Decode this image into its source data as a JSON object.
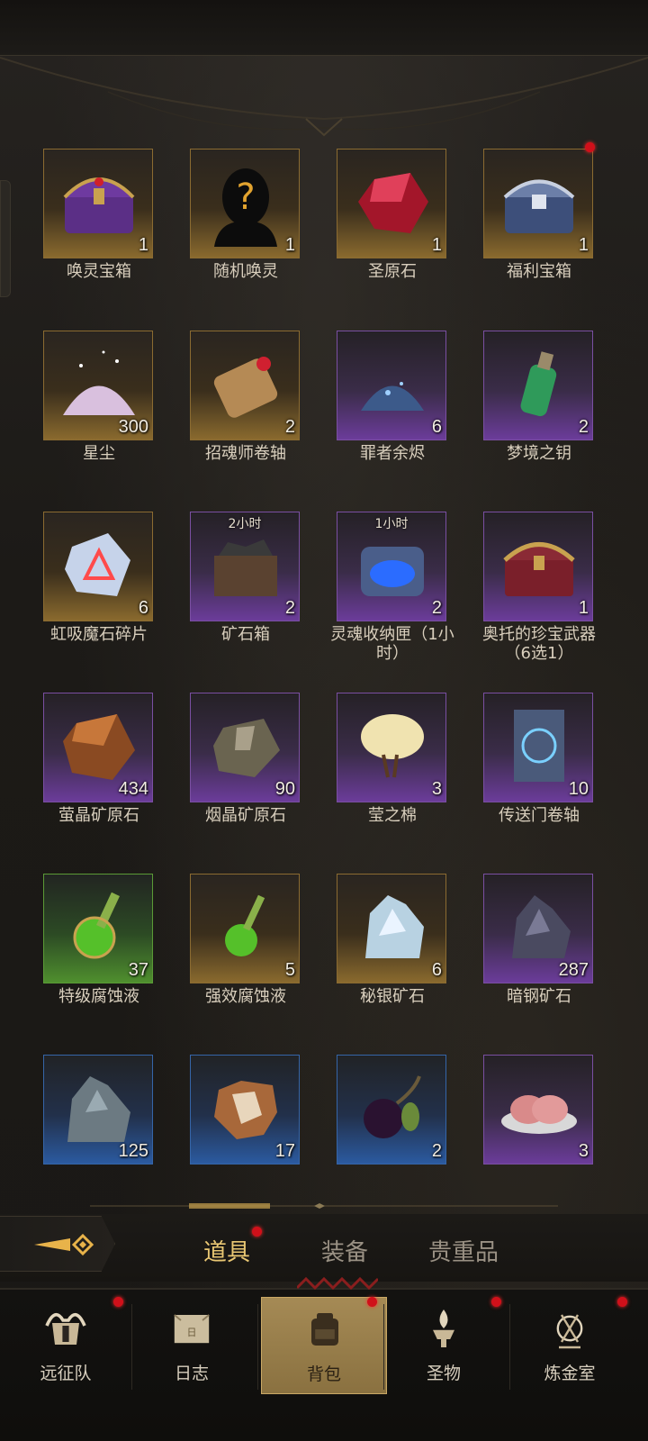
{
  "colors": {
    "gold_frame": "#8b6b31",
    "purple_frame": "#7a4fa2",
    "green_frame": "#5a9a36",
    "blue_frame": "#3565a8",
    "active_tab": "#e9c773",
    "notification_dot": "#d0101a"
  },
  "items": [
    {
      "name": "唤灵宝箱",
      "count": "1",
      "rarity": "gold",
      "icon": "purple-chest-icon",
      "dot": false,
      "timer": ""
    },
    {
      "name": "随机唤灵",
      "count": "1",
      "rarity": "gold",
      "icon": "mystery-silhouette-icon",
      "dot": false,
      "timer": ""
    },
    {
      "name": "圣原石",
      "count": "1",
      "rarity": "gold",
      "icon": "red-crystal-icon",
      "dot": false,
      "timer": ""
    },
    {
      "name": "福利宝箱",
      "count": "1",
      "rarity": "gold",
      "icon": "silver-chest-icon",
      "dot": true,
      "timer": ""
    },
    {
      "name": "星尘",
      "count": "300",
      "rarity": "gold",
      "icon": "stardust-pile-icon",
      "dot": false,
      "timer": ""
    },
    {
      "name": "招魂师卷轴",
      "count": "2",
      "rarity": "gold",
      "icon": "scroll-icon",
      "dot": false,
      "timer": ""
    },
    {
      "name": "罪者余烬",
      "count": "6",
      "rarity": "purple",
      "icon": "ember-pile-icon",
      "dot": false,
      "timer": ""
    },
    {
      "name": "梦境之钥",
      "count": "2",
      "rarity": "purple",
      "icon": "green-vial-icon",
      "dot": false,
      "timer": ""
    },
    {
      "name": "虹吸魔石碎片",
      "count": "6",
      "rarity": "gold",
      "icon": "rune-shard-icon",
      "dot": false,
      "timer": ""
    },
    {
      "name": "矿石箱",
      "count": "2",
      "rarity": "purple",
      "icon": "ore-crate-icon",
      "dot": false,
      "timer": "2小时"
    },
    {
      "name": "灵魂收纳匣（1小时）",
      "count": "2",
      "rarity": "purple",
      "icon": "soul-box-icon",
      "dot": false,
      "timer": "1小时"
    },
    {
      "name": "奥托的珍宝武器（6选1）",
      "count": "1",
      "rarity": "purple",
      "icon": "treasure-chest-icon",
      "dot": false,
      "timer": ""
    },
    {
      "name": "萤晶矿原石",
      "count": "434",
      "rarity": "purple",
      "icon": "amber-ore-icon",
      "dot": false,
      "timer": ""
    },
    {
      "name": "烟晶矿原石",
      "count": "90",
      "rarity": "purple",
      "icon": "smoky-ore-icon",
      "dot": false,
      "timer": ""
    },
    {
      "name": "莹之棉",
      "count": "3",
      "rarity": "purple",
      "icon": "cotton-icon",
      "dot": false,
      "timer": ""
    },
    {
      "name": "传送门卷轴",
      "count": "10",
      "rarity": "purple",
      "icon": "portal-scroll-icon",
      "dot": false,
      "timer": ""
    },
    {
      "name": "特级腐蚀液",
      "count": "37",
      "rarity": "green",
      "icon": "green-flask-icon",
      "dot": false,
      "timer": ""
    },
    {
      "name": "强效腐蚀液",
      "count": "5",
      "rarity": "gold",
      "icon": "green-flask-small-icon",
      "dot": false,
      "timer": ""
    },
    {
      "name": "秘银矿石",
      "count": "6",
      "rarity": "gold",
      "icon": "mithril-ore-icon",
      "dot": false,
      "timer": ""
    },
    {
      "name": "暗钢矿石",
      "count": "287",
      "rarity": "purple",
      "icon": "dark-steel-ore-icon",
      "dot": false,
      "timer": ""
    },
    {
      "name": "",
      "count": "125",
      "rarity": "blue",
      "icon": "stone-ore-icon",
      "dot": false,
      "timer": ""
    },
    {
      "name": "",
      "count": "17",
      "rarity": "blue",
      "icon": "hide-pelt-icon",
      "dot": false,
      "timer": ""
    },
    {
      "name": "",
      "count": "2",
      "rarity": "blue",
      "icon": "dark-fruit-icon",
      "dot": false,
      "timer": ""
    },
    {
      "name": "",
      "count": "3",
      "rarity": "purple",
      "icon": "raw-meat-icon",
      "dot": false,
      "timer": ""
    }
  ],
  "tabs": [
    {
      "label": "道具",
      "active": true,
      "dot": true
    },
    {
      "label": "装备",
      "active": false,
      "dot": false
    },
    {
      "label": "贵重品",
      "active": false,
      "dot": false
    }
  ],
  "nav": [
    {
      "label": "远征队",
      "icon": "horned-helmet-icon",
      "active": false,
      "dot": true
    },
    {
      "label": "日志",
      "icon": "map-scroll-icon",
      "active": false,
      "dot": false
    },
    {
      "label": "背包",
      "icon": "backpack-icon",
      "active": true,
      "dot": true
    },
    {
      "label": "圣物",
      "icon": "brazier-icon",
      "active": false,
      "dot": true
    },
    {
      "label": "炼金室",
      "icon": "alchemy-icon",
      "active": false,
      "dot": true
    }
  ]
}
